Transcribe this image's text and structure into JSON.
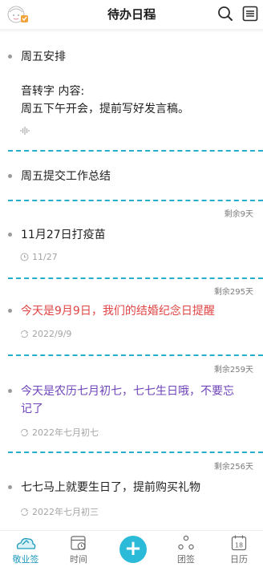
{
  "header": {
    "title": "待办日程",
    "avatar_icon": "avatar-icon",
    "search_icon": "search-icon",
    "menu_icon": "menu-icon"
  },
  "todos": [
    {
      "title": "周五安排",
      "note_lines": [
        "音转字 内容:",
        "周五下午开会，提前写好发言稿。"
      ],
      "meta_icon": "voice-icon"
    },
    {
      "title": "周五提交工作总结",
      "remaining": "剩余9天"
    },
    {
      "title": "11月27日打疫苗",
      "date": "11/27",
      "meta_icon": "clock-icon",
      "remaining": "剩余295天"
    },
    {
      "title": "今天是9月9日，我们的结婚纪念日提醒",
      "date": "2022/9/9",
      "meta_icon": "repeat-icon",
      "title_color": "#e04444",
      "remaining": "剩余259天"
    },
    {
      "title_lines": [
        "今天是农历七月初七，七七生日哦，不要忘",
        "记了"
      ],
      "date": "2022年七月初七",
      "meta_icon": "repeat-icon",
      "title_color": "#6f45b9",
      "remaining": "剩余256天"
    },
    {
      "title": "七七马上就要生日了，提前购买礼物",
      "date": "2022年七月初三",
      "meta_icon": "repeat-icon"
    }
  ],
  "tabbar": {
    "tabs": [
      {
        "label": "敬业签",
        "icon": "cloud-note-icon",
        "active": true
      },
      {
        "label": "时间",
        "icon": "calendar-clock-icon"
      },
      {
        "label": "",
        "icon": "add-icon"
      },
      {
        "label": "团签",
        "icon": "team-icon"
      },
      {
        "label": "日历",
        "icon": "calendar-icon",
        "badge": "18"
      }
    ],
    "fab_symbol": "+"
  },
  "colors": {
    "accent": "#25aecb",
    "fab": "#2bbbd8",
    "active_tab": "#1e9bbd",
    "red_text": "#e04444",
    "purple_text": "#6f45b9"
  }
}
